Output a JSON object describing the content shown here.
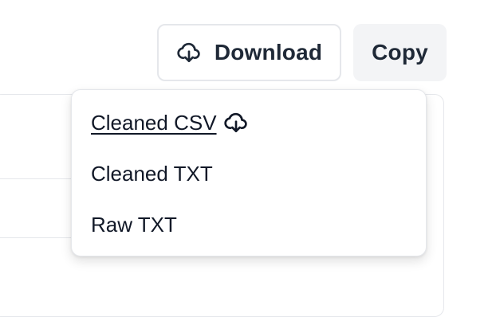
{
  "toolbar": {
    "download_label": "Download",
    "copy_label": "Copy",
    "download_icon": "cloud-download-icon"
  },
  "download_menu": {
    "items": [
      {
        "label": "Cleaned CSV",
        "icon": "cloud-download-icon",
        "highlighted": true
      },
      {
        "label": "Cleaned TXT"
      },
      {
        "label": "Raw TXT"
      }
    ]
  },
  "colors": {
    "text": "#1f2937",
    "border": "#e5e7eb",
    "copy_bg": "#f3f4f6"
  }
}
